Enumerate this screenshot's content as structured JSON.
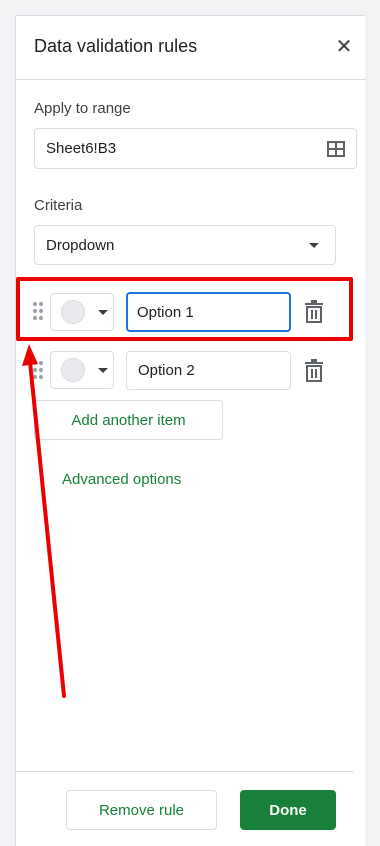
{
  "panel": {
    "title": "Data validation rules",
    "close_icon": "close-icon"
  },
  "range": {
    "label": "Apply to range",
    "value": "Sheet6!B3",
    "icon": "grid-select-icon"
  },
  "criteria": {
    "label": "Criteria",
    "selected": "Dropdown"
  },
  "options": [
    {
      "value": "Option 1",
      "color": "#e8eaed",
      "focused": true
    },
    {
      "value": "Option 2",
      "color": "#e8eaed",
      "focused": false
    }
  ],
  "add_item_label": "Add another item",
  "advanced_label": "Advanced options",
  "footer": {
    "remove_label": "Remove rule",
    "done_label": "Done"
  },
  "colors": {
    "accent": "#188038",
    "focus": "#1a73e8",
    "annotation": "#ee0000"
  }
}
